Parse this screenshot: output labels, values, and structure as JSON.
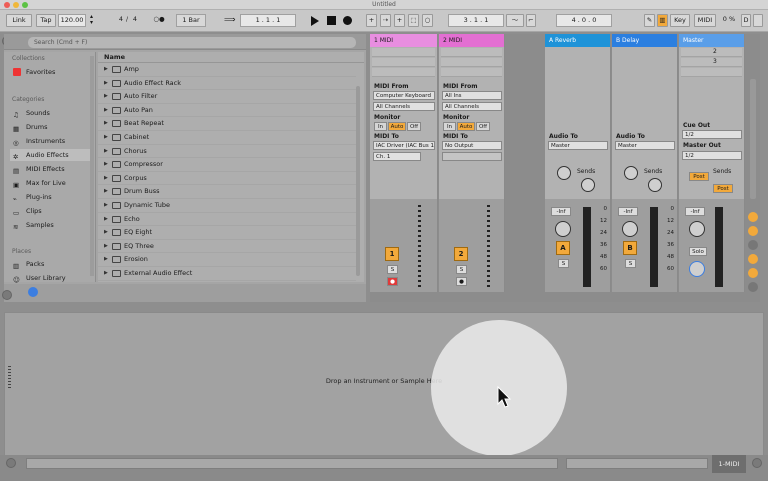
{
  "window": {
    "title": "Untitled"
  },
  "controlbar": {
    "link": "Link",
    "tap": "Tap",
    "tempo": "120.00",
    "signature_num": "4",
    "signature_den": "4",
    "metro": "○●",
    "quantize": "1 Bar",
    "position": "1 .   1 .   1",
    "loop_start": "3 .   1 .   1",
    "loop_len": "4 .   0 .   0",
    "key": "Key",
    "midi": "MIDI",
    "cpu": "0 %",
    "d_label": "D"
  },
  "browser": {
    "search_placeholder": "Search (Cmd + F)",
    "collections_header": "Collections",
    "favorites": "Favorites",
    "categories_header": "Categories",
    "categories": [
      "Sounds",
      "Drums",
      "Instruments",
      "Audio Effects",
      "MIDI Effects",
      "Max for Live",
      "Plug-ins",
      "Clips",
      "Samples"
    ],
    "places_header": "Places",
    "places": [
      "Packs",
      "User Library"
    ],
    "name_header": "Name",
    "items": [
      "Amp",
      "Audio Effect Rack",
      "Auto Filter",
      "Auto Pan",
      "Beat Repeat",
      "Cabinet",
      "Chorus",
      "Compressor",
      "Corpus",
      "Drum Buss",
      "Dynamic Tube",
      "Echo",
      "EQ Eight",
      "EQ Three",
      "Erosion",
      "External Audio Effect"
    ]
  },
  "session": {
    "tracks": [
      {
        "name": "1 MIDI",
        "color": "#e88ee0",
        "num": "1"
      },
      {
        "name": "2 MIDI",
        "color": "#e36fd2",
        "num": "2"
      }
    ],
    "returns": [
      {
        "name": "A Reverb",
        "color": "#1f93d8",
        "letter": "A"
      },
      {
        "name": "B Delay",
        "color": "#2b7fe0",
        "letter": "B"
      }
    ],
    "master": {
      "name": "Master",
      "color": "#5a9ee8",
      "scene2": "2",
      "scene3": "3"
    },
    "midi_from": "MIDI From",
    "midi_from_1": "Computer Keyboard",
    "midi_from_2": "All Ins",
    "all_channels": "All Channels",
    "monitor": "Monitor",
    "in": "In",
    "auto": "Auto",
    "off": "Off",
    "midi_to": "MIDI To",
    "midi_to_1": "IAC Driver (IAC Bus 1)",
    "midi_to_2": "No Output",
    "ch1": "Ch. 1",
    "audio_to": "Audio To",
    "audio_to_val": "Master",
    "cue_out": "Cue Out",
    "cue_out_val": "1/2",
    "master_out": "Master Out",
    "master_out_val": "1/2",
    "sends": "Sends",
    "post": "Post",
    "inf": "-Inf",
    "solo": "Solo",
    "scale": [
      "0",
      "12",
      "24",
      "36",
      "48",
      "60"
    ],
    "knob_a": "A",
    "knob_b": "B",
    "s": "S"
  },
  "detail": {
    "drop_text": "Drop an Instrument or Sample Here"
  },
  "status": {
    "track_label": "1-MIDI"
  }
}
